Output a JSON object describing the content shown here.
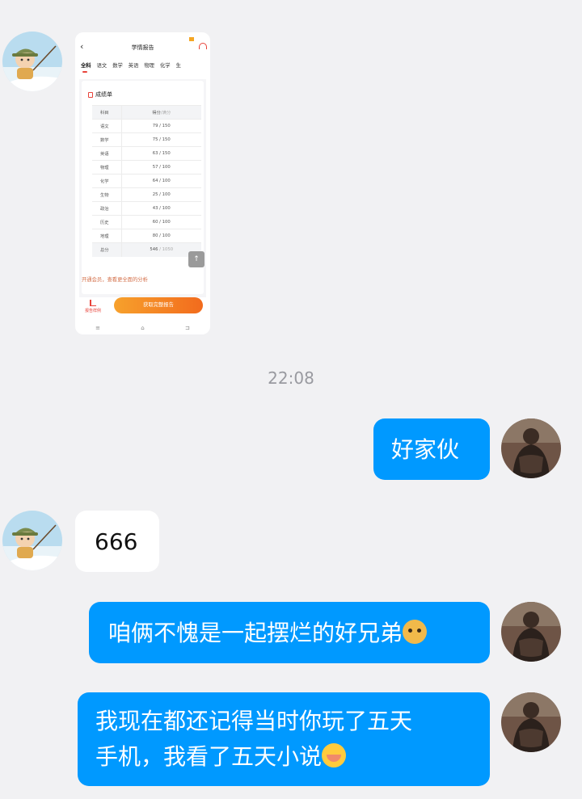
{
  "screenshot": {
    "title": "学情报告",
    "back": "‹",
    "tabs": [
      "全科",
      "语文",
      "数学",
      "英语",
      "物理",
      "化学",
      "生"
    ],
    "card_title": "成绩单",
    "table_header": {
      "subject": "科目",
      "score": "得分",
      "full": "/满分"
    },
    "rows": [
      {
        "subject": "语文",
        "score": "79 / 150"
      },
      {
        "subject": "数学",
        "score": "75 / 150"
      },
      {
        "subject": "英语",
        "score": "63 / 150"
      },
      {
        "subject": "物理",
        "score": "57 / 100"
      },
      {
        "subject": "化学",
        "score": "64 / 100"
      },
      {
        "subject": "生物",
        "score": "25 / 100"
      },
      {
        "subject": "政治",
        "score": "43 / 100"
      },
      {
        "subject": "历史",
        "score": "60 / 100"
      },
      {
        "subject": "地理",
        "score": "80 / 100"
      }
    ],
    "total": {
      "subject": "总分",
      "score": "546",
      "full": " / 1050"
    },
    "up_icon": "↑",
    "promo": "开通会员，查看更全面的分析",
    "report_example": "报告样例",
    "get_button": "获取完整报告",
    "nav": [
      "≡",
      "⌂",
      "⊐"
    ]
  },
  "timestamp": "22:08",
  "messages": [
    {
      "sender": "me",
      "text": "好家伙"
    },
    {
      "sender": "them",
      "text": "666"
    },
    {
      "sender": "me",
      "text": "咱俩不愧是一起摆烂的好兄弟",
      "emoji": "doge-icon"
    },
    {
      "sender": "me",
      "text_line1": "我现在都还记得当时你玩了五天",
      "text_line2": "手机，我看了五天小说",
      "emoji": "facepalm-icon"
    }
  ],
  "colors": {
    "my_bubble": "#0099ff",
    "their_bubble": "#ffffff",
    "background": "#f1f1f3"
  }
}
